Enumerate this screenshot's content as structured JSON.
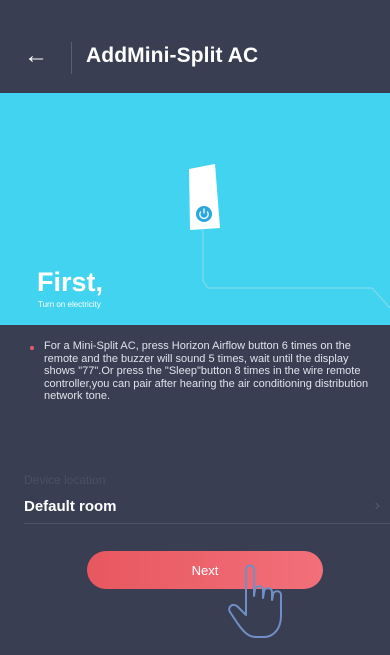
{
  "header": {
    "back_icon": "arrow-left-icon",
    "title": "AddMini-Split AC"
  },
  "hero": {
    "heading": "First,",
    "subheading": "Turn on electricity",
    "device_icon": "power-icon",
    "background_color": "#42d3f0"
  },
  "instructions": {
    "text": "For a Mini-Split AC, press Horizon Airflow button 6 times on the remote and the buzzer will sound 5 times, wait until the display shows \"77\".Or  press the \"Sleep\"button 8 times in the wire remote controller,you can pair after hearing the air conditioning distribution network tone."
  },
  "location": {
    "label": "Device location",
    "value": "Default room",
    "chevron_icon": "chevron-right-icon"
  },
  "actions": {
    "next_label": "Next",
    "accent_color": "#ee6570"
  },
  "overlay": {
    "hand_icon": "tap-hand-icon"
  }
}
